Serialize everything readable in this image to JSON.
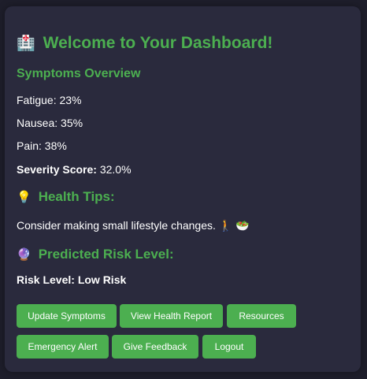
{
  "header": {
    "icon": "hospital-icon",
    "icon_glyph": "🏥",
    "title": "Welcome to Your Dashboard!"
  },
  "symptoms": {
    "heading": "Symptoms Overview",
    "fatigue": "Fatigue: 23%",
    "nausea": "Nausea: 35%",
    "pain": "Pain: 38%",
    "severity_label": "Severity Score:",
    "severity_value": " 32.0%"
  },
  "tips": {
    "icon": "lightbulb-icon",
    "icon_glyph": "💡",
    "heading": "Health Tips:",
    "text": "Consider making small lifestyle changes. 🚶 🥗"
  },
  "risk": {
    "icon": "crystal-ball-icon",
    "icon_glyph": "🔮",
    "heading": "Predicted Risk Level:",
    "label": "Risk Level: Low Risk"
  },
  "buttons": {
    "update_symptoms": "Update Symptoms",
    "view_health_report": "View Health Report",
    "resources": "Resources",
    "emergency_alert": "Emergency Alert",
    "give_feedback": "Give Feedback",
    "logout": "Logout"
  },
  "colors": {
    "accent": "#4caf50",
    "card_bg": "#2a2a3d",
    "page_bg": "#1e1e2b",
    "text": "#ffffff"
  }
}
